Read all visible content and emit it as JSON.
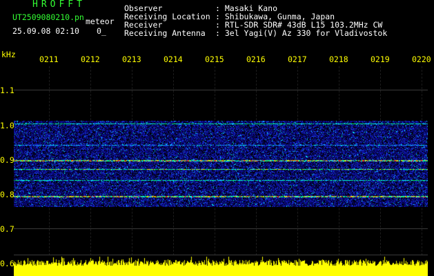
{
  "header": {
    "app_title": "HROFFT",
    "file_name": "UT2509080210.pn",
    "type_label": "meteor",
    "date_time": "25.09.08 02:10",
    "stray_text": "0_",
    "info_labels": "Observer\nReceiving Location\nReceiver\nReceiving Antenna",
    "info_values": ": Masaki Kano\n: Shibukawa, Gunma, Japan\n: RTL-SDR SDR# 43dB L15 103.2MHz CW\n: 3el Yagi(V) Az 330 for Vladivostok"
  },
  "axes": {
    "y_unit": "kHz",
    "y_labels": [
      "1.1",
      "1.0",
      "0.9",
      "0.8",
      "0.7",
      "0.6"
    ],
    "x_labels": [
      "0211",
      "0212",
      "0213",
      "0214",
      "0215",
      "0216",
      "0217",
      "0218",
      "0219",
      "0220"
    ]
  },
  "display": {
    "spectrogram_colors": [
      "#0a0a8a",
      "#1f4cff",
      "#00ffff",
      "#00ff66",
      "#ffff00",
      "#ff2020"
    ],
    "power_color": "#ffff00",
    "text_colors": {
      "title": "#33ff33",
      "info": "#ffffff",
      "axis": "#ffff00"
    }
  }
}
